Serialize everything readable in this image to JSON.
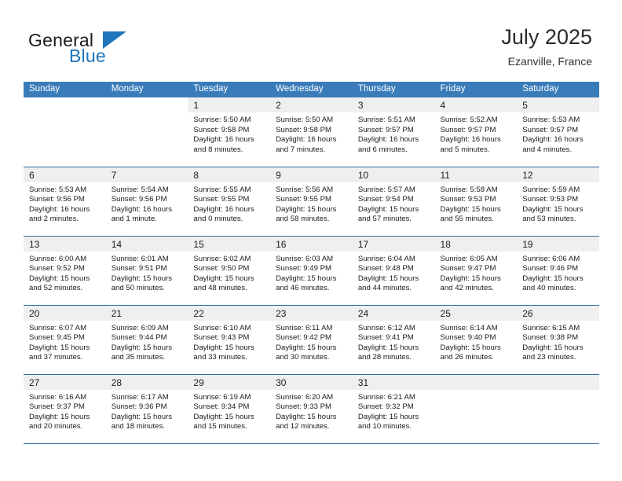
{
  "brand": {
    "name_part1": "General",
    "name_part2": "Blue",
    "flag_icon": "triangle-flag-icon",
    "color_primary": "#1f76bc",
    "color_text": "#1b1b1b"
  },
  "header": {
    "title": "July 2025",
    "subtitle": "Ezanville, France"
  },
  "calendar": {
    "header_bg": "#3a7cba",
    "header_text_color": "#ffffff",
    "date_band_bg": "#efefef",
    "row_rule_color": "#2e6da4",
    "weekday_headers": [
      "Sunday",
      "Monday",
      "Tuesday",
      "Wednesday",
      "Thursday",
      "Friday",
      "Saturday"
    ],
    "weeks": [
      [
        {
          "day": "",
          "lines": []
        },
        {
          "day": "",
          "lines": []
        },
        {
          "day": "1",
          "lines": [
            "Sunrise: 5:50 AM",
            "Sunset: 9:58 PM",
            "Daylight: 16 hours",
            "and 8 minutes."
          ]
        },
        {
          "day": "2",
          "lines": [
            "Sunrise: 5:50 AM",
            "Sunset: 9:58 PM",
            "Daylight: 16 hours",
            "and 7 minutes."
          ]
        },
        {
          "day": "3",
          "lines": [
            "Sunrise: 5:51 AM",
            "Sunset: 9:57 PM",
            "Daylight: 16 hours",
            "and 6 minutes."
          ]
        },
        {
          "day": "4",
          "lines": [
            "Sunrise: 5:52 AM",
            "Sunset: 9:57 PM",
            "Daylight: 16 hours",
            "and 5 minutes."
          ]
        },
        {
          "day": "5",
          "lines": [
            "Sunrise: 5:53 AM",
            "Sunset: 9:57 PM",
            "Daylight: 16 hours",
            "and 4 minutes."
          ]
        }
      ],
      [
        {
          "day": "6",
          "lines": [
            "Sunrise: 5:53 AM",
            "Sunset: 9:56 PM",
            "Daylight: 16 hours",
            "and 2 minutes."
          ]
        },
        {
          "day": "7",
          "lines": [
            "Sunrise: 5:54 AM",
            "Sunset: 9:56 PM",
            "Daylight: 16 hours",
            "and 1 minute."
          ]
        },
        {
          "day": "8",
          "lines": [
            "Sunrise: 5:55 AM",
            "Sunset: 9:55 PM",
            "Daylight: 16 hours",
            "and 0 minutes."
          ]
        },
        {
          "day": "9",
          "lines": [
            "Sunrise: 5:56 AM",
            "Sunset: 9:55 PM",
            "Daylight: 15 hours",
            "and 58 minutes."
          ]
        },
        {
          "day": "10",
          "lines": [
            "Sunrise: 5:57 AM",
            "Sunset: 9:54 PM",
            "Daylight: 15 hours",
            "and 57 minutes."
          ]
        },
        {
          "day": "11",
          "lines": [
            "Sunrise: 5:58 AM",
            "Sunset: 9:53 PM",
            "Daylight: 15 hours",
            "and 55 minutes."
          ]
        },
        {
          "day": "12",
          "lines": [
            "Sunrise: 5:59 AM",
            "Sunset: 9:53 PM",
            "Daylight: 15 hours",
            "and 53 minutes."
          ]
        }
      ],
      [
        {
          "day": "13",
          "lines": [
            "Sunrise: 6:00 AM",
            "Sunset: 9:52 PM",
            "Daylight: 15 hours",
            "and 52 minutes."
          ]
        },
        {
          "day": "14",
          "lines": [
            "Sunrise: 6:01 AM",
            "Sunset: 9:51 PM",
            "Daylight: 15 hours",
            "and 50 minutes."
          ]
        },
        {
          "day": "15",
          "lines": [
            "Sunrise: 6:02 AM",
            "Sunset: 9:50 PM",
            "Daylight: 15 hours",
            "and 48 minutes."
          ]
        },
        {
          "day": "16",
          "lines": [
            "Sunrise: 6:03 AM",
            "Sunset: 9:49 PM",
            "Daylight: 15 hours",
            "and 46 minutes."
          ]
        },
        {
          "day": "17",
          "lines": [
            "Sunrise: 6:04 AM",
            "Sunset: 9:48 PM",
            "Daylight: 15 hours",
            "and 44 minutes."
          ]
        },
        {
          "day": "18",
          "lines": [
            "Sunrise: 6:05 AM",
            "Sunset: 9:47 PM",
            "Daylight: 15 hours",
            "and 42 minutes."
          ]
        },
        {
          "day": "19",
          "lines": [
            "Sunrise: 6:06 AM",
            "Sunset: 9:46 PM",
            "Daylight: 15 hours",
            "and 40 minutes."
          ]
        }
      ],
      [
        {
          "day": "20",
          "lines": [
            "Sunrise: 6:07 AM",
            "Sunset: 9:45 PM",
            "Daylight: 15 hours",
            "and 37 minutes."
          ]
        },
        {
          "day": "21",
          "lines": [
            "Sunrise: 6:09 AM",
            "Sunset: 9:44 PM",
            "Daylight: 15 hours",
            "and 35 minutes."
          ]
        },
        {
          "day": "22",
          "lines": [
            "Sunrise: 6:10 AM",
            "Sunset: 9:43 PM",
            "Daylight: 15 hours",
            "and 33 minutes."
          ]
        },
        {
          "day": "23",
          "lines": [
            "Sunrise: 6:11 AM",
            "Sunset: 9:42 PM",
            "Daylight: 15 hours",
            "and 30 minutes."
          ]
        },
        {
          "day": "24",
          "lines": [
            "Sunrise: 6:12 AM",
            "Sunset: 9:41 PM",
            "Daylight: 15 hours",
            "and 28 minutes."
          ]
        },
        {
          "day": "25",
          "lines": [
            "Sunrise: 6:14 AM",
            "Sunset: 9:40 PM",
            "Daylight: 15 hours",
            "and 26 minutes."
          ]
        },
        {
          "day": "26",
          "lines": [
            "Sunrise: 6:15 AM",
            "Sunset: 9:38 PM",
            "Daylight: 15 hours",
            "and 23 minutes."
          ]
        }
      ],
      [
        {
          "day": "27",
          "lines": [
            "Sunrise: 6:16 AM",
            "Sunset: 9:37 PM",
            "Daylight: 15 hours",
            "and 20 minutes."
          ]
        },
        {
          "day": "28",
          "lines": [
            "Sunrise: 6:17 AM",
            "Sunset: 9:36 PM",
            "Daylight: 15 hours",
            "and 18 minutes."
          ]
        },
        {
          "day": "29",
          "lines": [
            "Sunrise: 6:19 AM",
            "Sunset: 9:34 PM",
            "Daylight: 15 hours",
            "and 15 minutes."
          ]
        },
        {
          "day": "30",
          "lines": [
            "Sunrise: 6:20 AM",
            "Sunset: 9:33 PM",
            "Daylight: 15 hours",
            "and 12 minutes."
          ]
        },
        {
          "day": "31",
          "lines": [
            "Sunrise: 6:21 AM",
            "Sunset: 9:32 PM",
            "Daylight: 15 hours",
            "and 10 minutes."
          ]
        },
        {
          "day": "",
          "lines": []
        },
        {
          "day": "",
          "lines": []
        }
      ]
    ]
  }
}
